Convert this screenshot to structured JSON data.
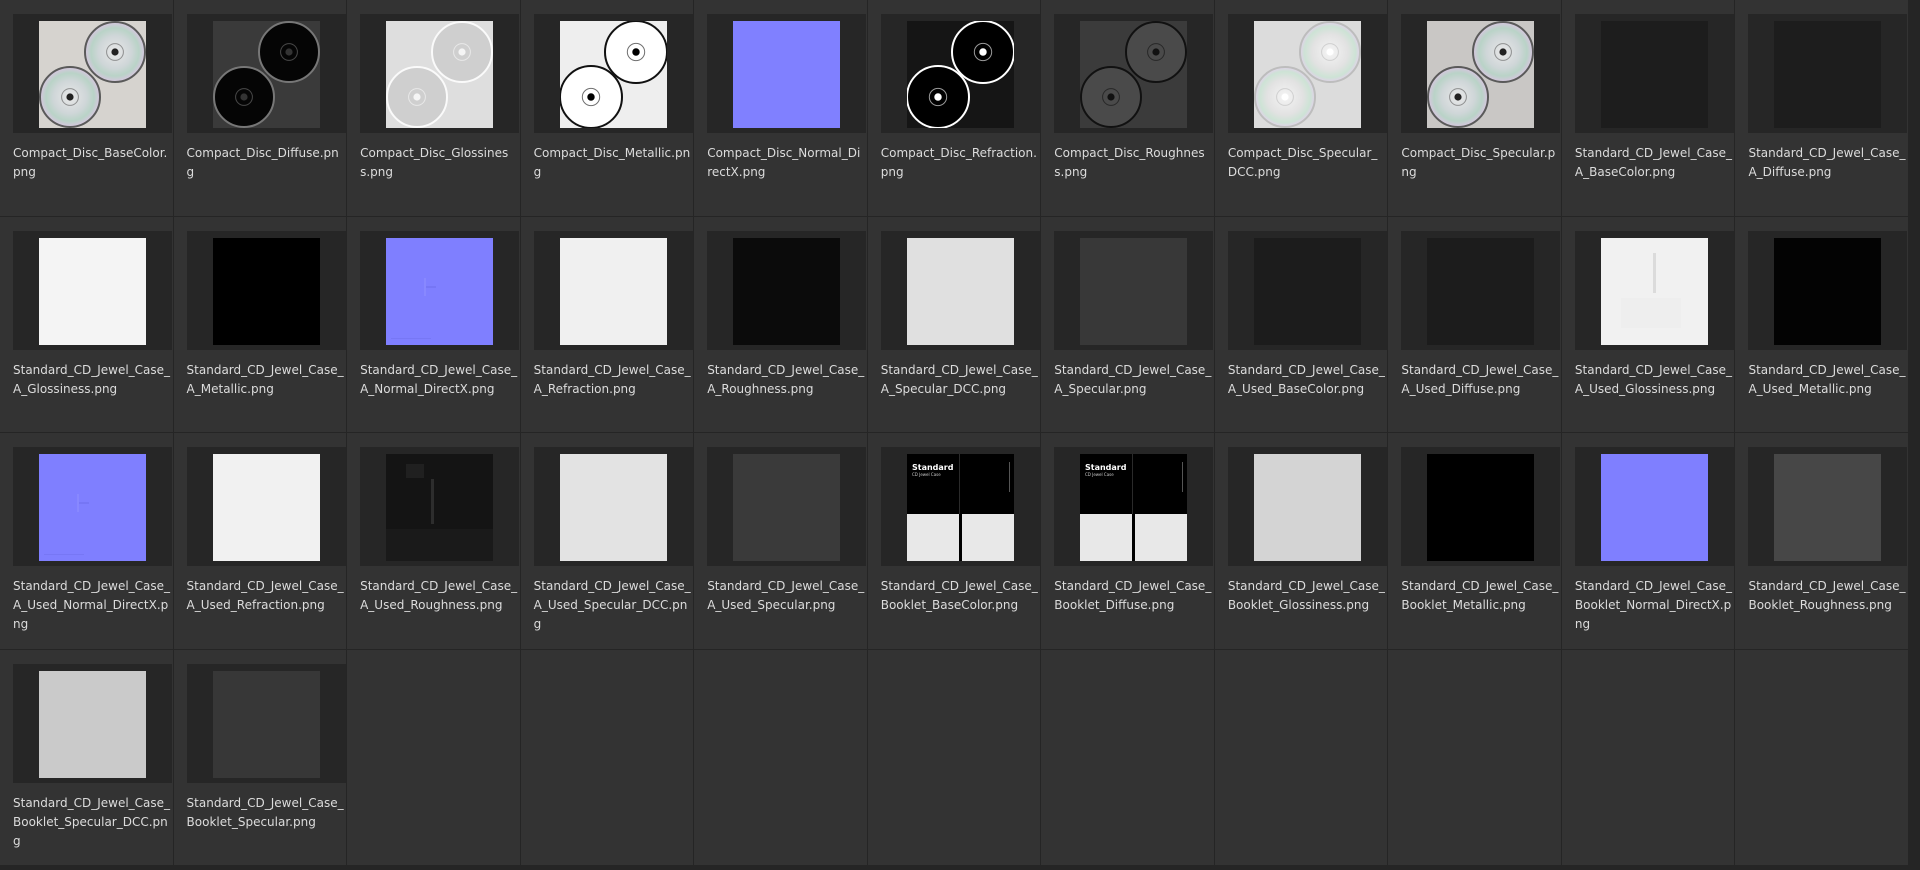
{
  "files": [
    {
      "name": "Compact_Disc_BaseColor.png",
      "thumb": "cd-color-2",
      "colors": {
        "bg": "#d6d3cf"
      }
    },
    {
      "name": "Compact_Disc_Diffuse.png",
      "thumb": "cd-black-2",
      "colors": {
        "bg": "#3a3a3a"
      }
    },
    {
      "name": "Compact_Disc_Glossiness.png",
      "thumb": "cd-light-2",
      "colors": {
        "bg": "#dedede"
      }
    },
    {
      "name": "Compact_Disc_Metallic.png",
      "thumb": "cd-white-on-white",
      "colors": {
        "bg": "#eeeeee"
      }
    },
    {
      "name": "Compact_Disc_Normal_DirectX.png",
      "thumb": "solid",
      "colors": {
        "bg": "#8080ff"
      }
    },
    {
      "name": "Compact_Disc_Refraction.png",
      "thumb": "cd-white-on-black",
      "colors": {
        "bg": "#151515"
      }
    },
    {
      "name": "Compact_Disc_Roughness.png",
      "thumb": "cd-dark-2",
      "colors": {
        "bg": "#3b3b3b"
      }
    },
    {
      "name": "Compact_Disc_Specular_DCC.png",
      "thumb": "cd-color-light",
      "colors": {
        "bg": "#dcdcdc"
      }
    },
    {
      "name": "Compact_Disc_Specular.png",
      "thumb": "cd-color-2",
      "colors": {
        "bg": "#c9c7c5"
      }
    },
    {
      "name": "Standard_CD_Jewel_Case_A_BaseColor.png",
      "thumb": "solid",
      "colors": {
        "bg": "#1d1d1d"
      }
    },
    {
      "name": "Standard_CD_Jewel_Case_A_Diffuse.png",
      "thumb": "solid",
      "colors": {
        "bg": "#1d1d1d"
      }
    },
    {
      "name": "Standard_CD_Jewel_Case_A_Glossiness.png",
      "thumb": "solid",
      "colors": {
        "bg": "#f4f4f4"
      }
    },
    {
      "name": "Standard_CD_Jewel_Case_A_Metallic.png",
      "thumb": "solid",
      "colors": {
        "bg": "#000000"
      }
    },
    {
      "name": "Standard_CD_Jewel_Case_A_Normal_DirectX.png",
      "thumb": "normal-detail",
      "colors": {
        "bg": "#7f7fff"
      }
    },
    {
      "name": "Standard_CD_Jewel_Case_A_Refraction.png",
      "thumb": "solid",
      "colors": {
        "bg": "#f0f0f0"
      }
    },
    {
      "name": "Standard_CD_Jewel_Case_A_Roughness.png",
      "thumb": "solid",
      "colors": {
        "bg": "#0b0b0b"
      }
    },
    {
      "name": "Standard_CD_Jewel_Case_A_Specular_DCC.png",
      "thumb": "solid",
      "colors": {
        "bg": "#e0e0e0"
      }
    },
    {
      "name": "Standard_CD_Jewel_Case_A_Specular.png",
      "thumb": "solid",
      "colors": {
        "bg": "#383838"
      }
    },
    {
      "name": "Standard_CD_Jewel_Case_A_Used_BaseColor.png",
      "thumb": "solid",
      "colors": {
        "bg": "#1c1c1c"
      }
    },
    {
      "name": "Standard_CD_Jewel_Case_A_Used_Diffuse.png",
      "thumb": "solid",
      "colors": {
        "bg": "#1c1c1c"
      }
    },
    {
      "name": "Standard_CD_Jewel_Case_A_Used_Glossiness.png",
      "thumb": "gloss-detail",
      "colors": {
        "bg": "#f1f1f1"
      }
    },
    {
      "name": "Standard_CD_Jewel_Case_A_Used_Metallic.png",
      "thumb": "solid",
      "colors": {
        "bg": "#030303"
      }
    },
    {
      "name": "Standard_CD_Jewel_Case_A_Used_Normal_DirectX.png",
      "thumb": "normal-detail",
      "colors": {
        "bg": "#7f7fff"
      }
    },
    {
      "name": "Standard_CD_Jewel_Case_A_Used_Refraction.png",
      "thumb": "solid",
      "colors": {
        "bg": "#f1f1f1"
      }
    },
    {
      "name": "Standard_CD_Jewel_Case_A_Used_Roughness.png",
      "thumb": "rough-detail",
      "colors": {
        "bg": "#141414"
      }
    },
    {
      "name": "Standard_CD_Jewel_Case_A_Used_Specular_DCC.png",
      "thumb": "solid",
      "colors": {
        "bg": "#e3e3e3"
      }
    },
    {
      "name": "Standard_CD_Jewel_Case_A_Used_Specular.png",
      "thumb": "solid",
      "colors": {
        "bg": "#3a3a3a"
      }
    },
    {
      "name": "Standard_CD_Jewel_Case_Booklet_BaseColor.png",
      "thumb": "booklet",
      "colors": {
        "bg": "#000000"
      }
    },
    {
      "name": "Standard_CD_Jewel_Case_Booklet_Diffuse.png",
      "thumb": "booklet",
      "colors": {
        "bg": "#000000"
      }
    },
    {
      "name": "Standard_CD_Jewel_Case_Booklet_Glossiness.png",
      "thumb": "solid",
      "colors": {
        "bg": "#d4d4d4"
      }
    },
    {
      "name": "Standard_CD_Jewel_Case_Booklet_Metallic.png",
      "thumb": "solid",
      "colors": {
        "bg": "#000000"
      }
    },
    {
      "name": "Standard_CD_Jewel_Case_Booklet_Normal_DirectX.png",
      "thumb": "solid",
      "colors": {
        "bg": "#7f7fff"
      }
    },
    {
      "name": "Standard_CD_Jewel_Case_Booklet_Roughness.png",
      "thumb": "solid",
      "colors": {
        "bg": "#474747"
      }
    },
    {
      "name": "Standard_CD_Jewel_Case_Booklet_Specular_DCC.png",
      "thumb": "solid",
      "colors": {
        "bg": "#cacaca"
      }
    },
    {
      "name": "Standard_CD_Jewel_Case_Booklet_Specular.png",
      "thumb": "solid",
      "colors": {
        "bg": "#373737"
      }
    }
  ],
  "booklet_text": {
    "title": "Standard",
    "subtitle": "CD Jewel Case"
  },
  "theme": {
    "panel": "#333333",
    "gap": "#252525",
    "thumb_box": "#262626",
    "text": "#dcdcdc"
  }
}
